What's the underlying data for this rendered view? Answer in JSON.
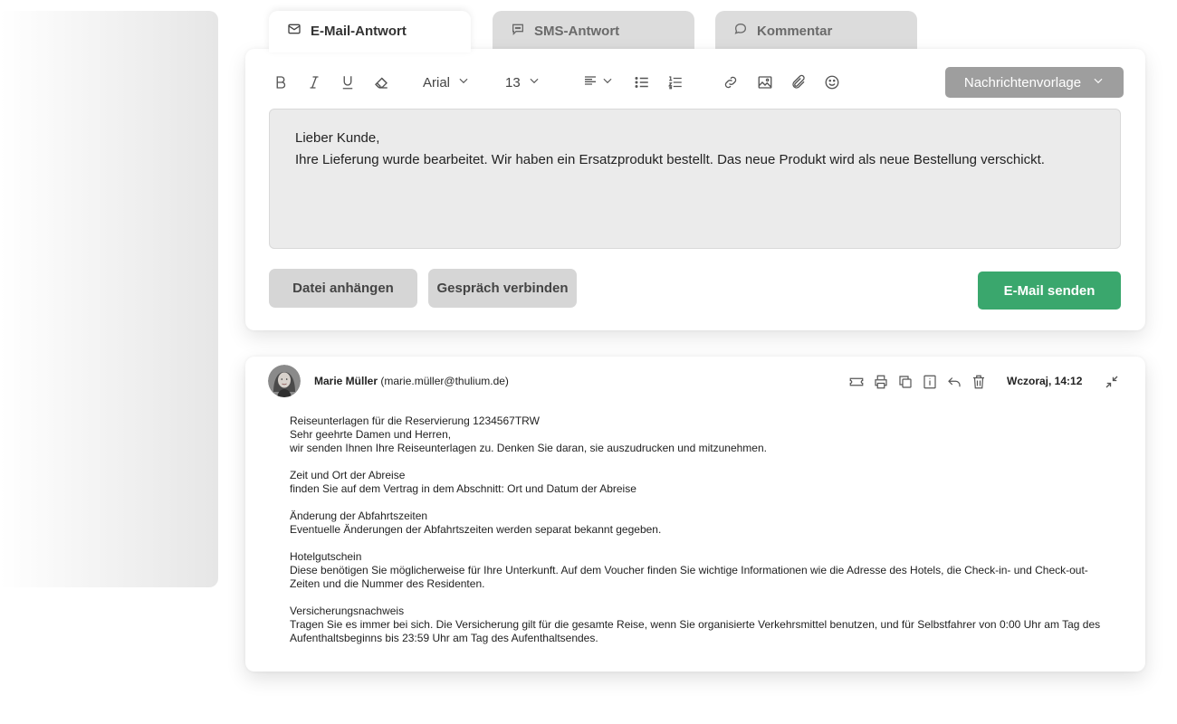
{
  "tabs": [
    {
      "label": "E-Mail-Antwort",
      "icon": "envelope-icon",
      "active": true
    },
    {
      "label": "SMS-Antwort",
      "icon": "sms-bubble-icon",
      "active": false
    },
    {
      "label": "Kommentar",
      "icon": "comment-bubble-icon",
      "active": false
    }
  ],
  "toolbar": {
    "font": "Arial",
    "size": "13",
    "template_label": "Nachrichtenvorlage"
  },
  "editor": {
    "lines": [
      "Lieber Kunde,",
      "Ihre Lieferung wurde bearbeitet. Wir haben ein Ersatzprodukt bestellt. Das neue Produkt wird als neue Bestellung verschickt."
    ]
  },
  "actions": {
    "attach": "Datei anhängen",
    "connect": "Gespräch verbinden",
    "send": "E-Mail senden"
  },
  "mail": {
    "sender_name": "Marie Müller",
    "sender_email": "(marie.müller@thulium.de)",
    "date": "Wczoraj, 14:12",
    "paragraphs": [
      [
        "Reiseunterlagen für die Reservierung 1234567TRW",
        "Sehr geehrte Damen und Herren,",
        "wir senden Ihnen Ihre Reiseunterlagen zu. Denken Sie daran, sie auszudrucken und mitzunehmen."
      ],
      [
        "Zeit und Ort der Abreise",
        "finden Sie auf dem Vertrag in dem Abschnitt: Ort und Datum der Abreise"
      ],
      [
        "Änderung der Abfahrtszeiten",
        "Eventuelle Änderungen der Abfahrtszeiten werden separat bekannt gegeben."
      ],
      [
        "Hotelgutschein",
        "Diese benötigen Sie möglicherweise für Ihre Unterkunft. Auf dem Voucher finden Sie wichtige Informationen wie die Adresse des Hotels, die Check-in- und Check-out-Zeiten und die Nummer des Residenten."
      ],
      [
        "Versicherungsnachweis",
        "Tragen Sie es immer bei sich. Die Versicherung gilt für die gesamte Reise, wenn Sie organisierte Verkehrsmittel benutzen, und für Selbstfahrer von 0:00 Uhr am Tag des Aufenthaltsbeginns bis 23:59 Uhr am Tag des Aufenthaltsendes."
      ]
    ]
  },
  "colors": {
    "send": "#3aa76d",
    "template": "#9e9e9e",
    "tab_inactive": "#dcdcdc",
    "editor_bg": "#ebebeb"
  }
}
